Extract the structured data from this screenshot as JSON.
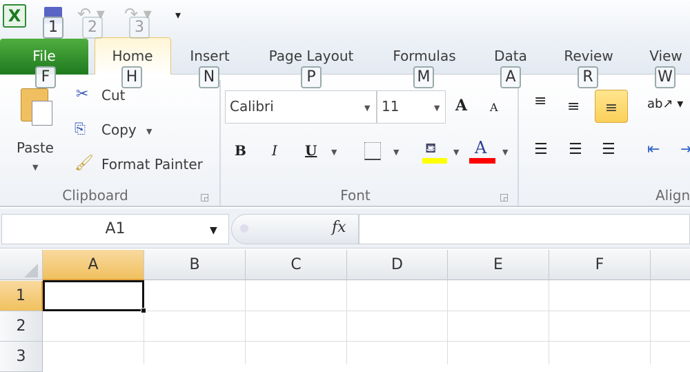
{
  "quick_access": {
    "keytips": [
      "1",
      "2",
      "3"
    ]
  },
  "tabs": [
    {
      "label": "File",
      "key": "F"
    },
    {
      "label": "Home",
      "key": "H"
    },
    {
      "label": "Insert",
      "key": "N"
    },
    {
      "label": "Page Layout",
      "key": "P"
    },
    {
      "label": "Formulas",
      "key": "M"
    },
    {
      "label": "Data",
      "key": "A"
    },
    {
      "label": "Review",
      "key": "R"
    },
    {
      "label": "View",
      "key": "W"
    }
  ],
  "clipboard": {
    "paste": "Paste",
    "cut": "Cut",
    "copy": "Copy",
    "format_painter": "Format Painter",
    "group": "Clipboard"
  },
  "font": {
    "name": "Calibri",
    "size": "11",
    "group": "Font",
    "fill_color": "#ffff00",
    "font_color": "#ff0000",
    "bold": "B",
    "italic": "I",
    "underline": "U",
    "grow": "A",
    "shrink": "A"
  },
  "alignment": {
    "group": "Align"
  },
  "formula_bar": {
    "name_box": "A1",
    "fx": "fx",
    "value": ""
  },
  "grid": {
    "columns": [
      "A",
      "B",
      "C",
      "D",
      "E",
      "F"
    ],
    "rows": [
      "1",
      "2",
      "3"
    ],
    "active_cell": "A1"
  }
}
